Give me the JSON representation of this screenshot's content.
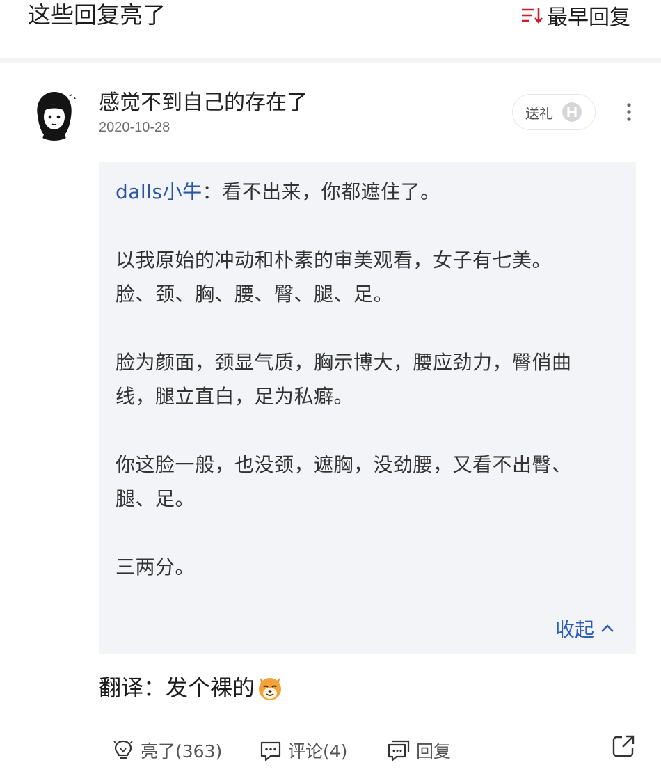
{
  "header": {
    "section_title": "这些回复亮了",
    "sort_label": "最早回复",
    "sort_icon": "sort-icon"
  },
  "post": {
    "username": "感觉不到自己的存在了",
    "date": "2020-10-28",
    "gift_label": "送礼",
    "gift_icon": "hupu-icon",
    "more_icon": "more-vertical-icon"
  },
  "quote": {
    "author": "dalls小牛",
    "separator": "：",
    "lines": [
      "看不出来，你都遮住了。",
      "以我原始的冲动和朴素的审美观看，女子有七美。",
      "脸、颈、胸、腰、臀、腿、足。",
      "脸为颜面，颈显气质，胸示博大，腰应劲力，臀俏曲",
      "线，腿立直白，足为私癖。",
      "你这脸一般，也没颈，遮胸，没劲腰，又看不出臀、",
      "腿、足。",
      "三两分。"
    ],
    "collapse_label": "收起",
    "collapse_icon": "chevron-up-icon"
  },
  "reply": {
    "text": "翻译：发个裸的",
    "emoji": "dog-face-emoji"
  },
  "actions": {
    "like_label": "亮了(363)",
    "comment_label": "评论(4)",
    "reply_label": "回复",
    "like_icon": "lightbulb-icon",
    "comment_icon": "comment-icon",
    "reply_icon": "reply-icon",
    "share_icon": "share-icon"
  },
  "colors": {
    "link_blue": "#2755a8",
    "quote_bg": "#f3f4f7",
    "sort_red": "#c8202c"
  }
}
